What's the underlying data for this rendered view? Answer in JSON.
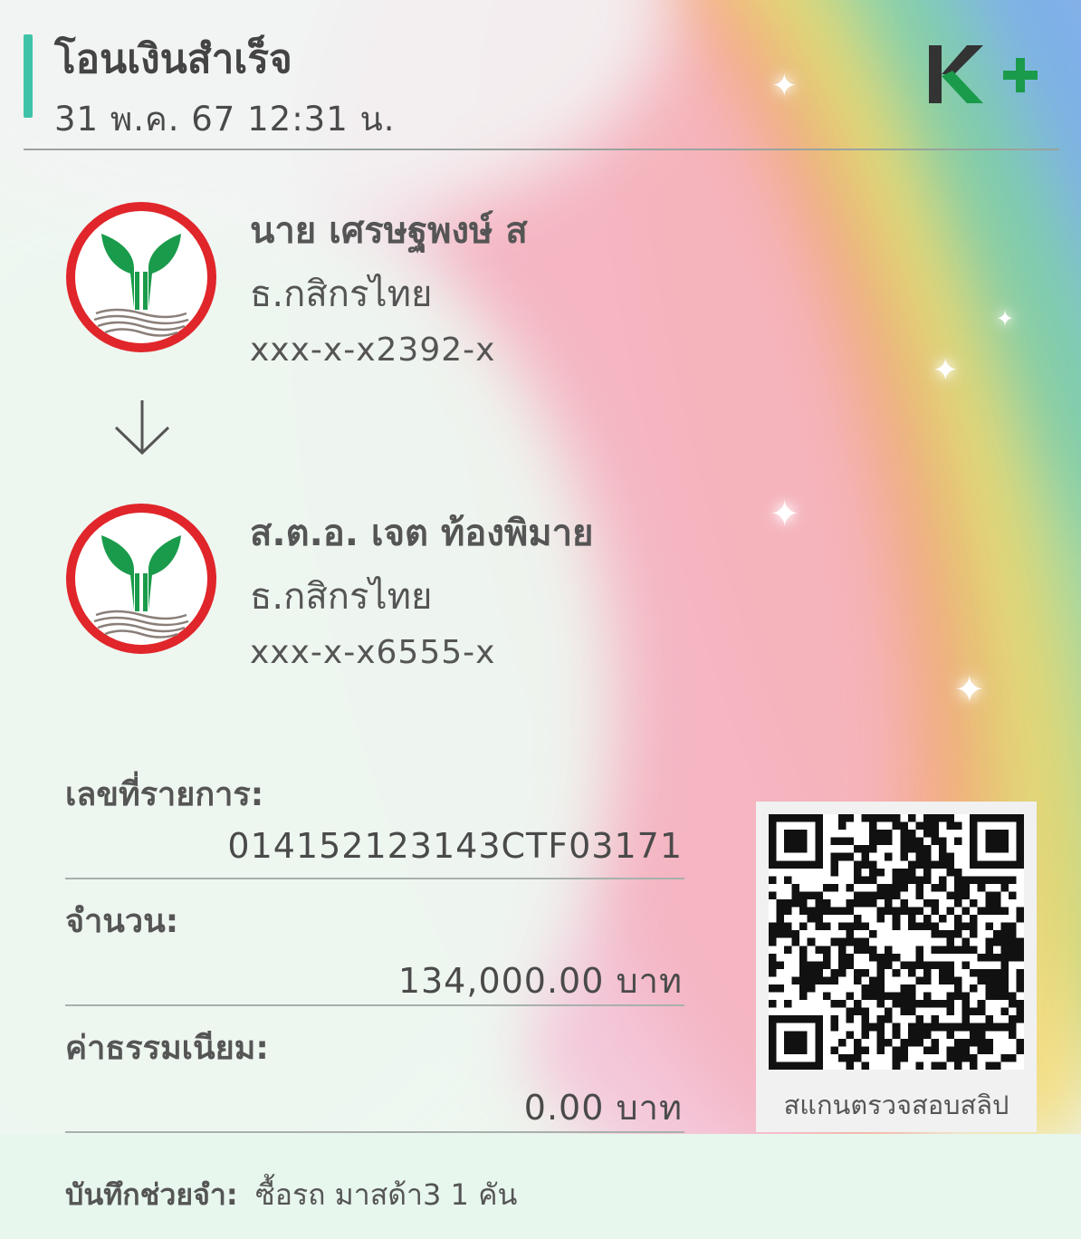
{
  "header": {
    "title": "โอนเงินสำเร็จ",
    "datetime": "31 พ.ค. 67  12:31 น.",
    "logo_text": "K+"
  },
  "sender": {
    "name": "นาย เศรษฐพงษ์ ส",
    "bank": "ธ.กสิกรไทย",
    "account": "xxx-x-x2392-x"
  },
  "receiver": {
    "name": "ส.ต.อ. เจต ท้องพิมาย",
    "bank": "ธ.กสิกรไทย",
    "account": "xxx-x-x6555-x"
  },
  "details": {
    "ref_label": "เลขที่รายการ:",
    "ref_value": "014152123143CTF03171",
    "amount_label": "จำนวน:",
    "amount_value": "134,000.00 บาท",
    "fee_label": "ค่าธรรมเนียม:",
    "fee_value": "0.00 บาท"
  },
  "qr": {
    "caption": "สแกนตรวจสอบสลิป"
  },
  "memo": {
    "label": "บันทึกช่วยจำ:",
    "value": "ซื้อรถ มาสด้า3 1 คัน"
  },
  "colors": {
    "accent": "#3fc3a8",
    "kbank_green": "#1a9b4b",
    "kbank_red": "#e0262a",
    "logo_dark": "#333333"
  },
  "icons": {
    "arrow": "arrow-down-icon",
    "sparkle": "sparkle-icon",
    "bank": "kbank-logo-icon"
  }
}
